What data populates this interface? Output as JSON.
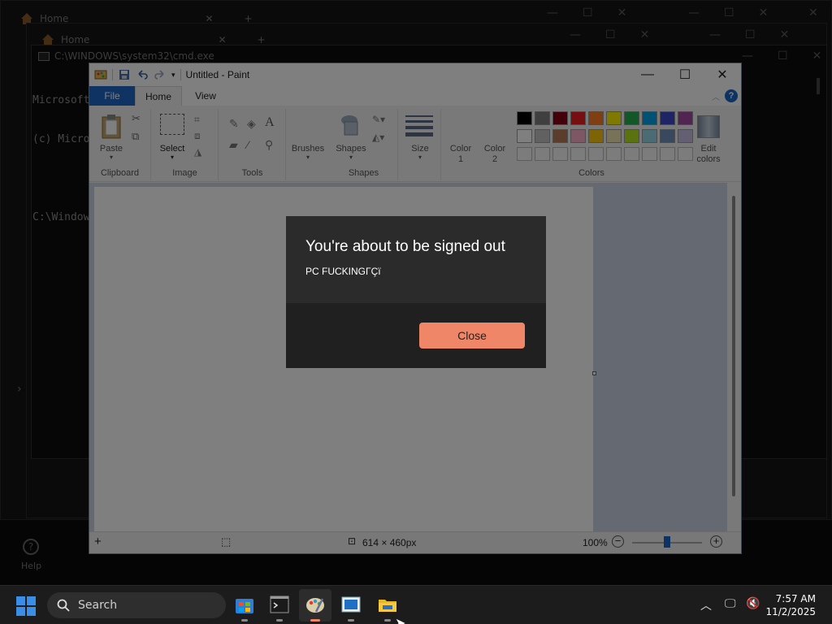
{
  "background_windows": {
    "tab1_label": "Home",
    "tab2_label": "Home",
    "help_label": "Help"
  },
  "cmd": {
    "title": "C:\\WINDOWS\\system32\\cmd.exe",
    "lines": [
      "Microsoft",
      "(c) Micro",
      "",
      "C:\\Window"
    ]
  },
  "paint": {
    "title": "Untitled - Paint",
    "menu": {
      "file": "File",
      "home": "Home",
      "view": "View"
    },
    "ribbon": {
      "paste": "Paste",
      "select": "Select",
      "brushes": "Brushes",
      "shapes": "Shapes",
      "size": "Size",
      "color1": "Color\n1",
      "color2": "Color\n2",
      "edit_colors": "Edit\ncolors",
      "groups": {
        "clipboard": "Clipboard",
        "image": "Image",
        "tools": "Tools",
        "shapes": "Shapes",
        "colors": "Colors"
      }
    },
    "palette_row1": [
      "#000000",
      "#7f7f7f",
      "#880015",
      "#ed1c24",
      "#ff7f27",
      "#fff200",
      "#22b14c",
      "#00a2e8",
      "#3f48cc",
      "#a349a4"
    ],
    "palette_row2": [
      "#ffffff",
      "#c3c3c3",
      "#b97a57",
      "#ffaec9",
      "#ffc90e",
      "#efe4b0",
      "#b5e61d",
      "#99d9ea",
      "#7092be",
      "#c8bfe7"
    ],
    "status": {
      "canvas_size": "614 × 460px",
      "zoom": "100%"
    }
  },
  "dialog": {
    "title": "You're about to be signed out",
    "message": "PC FUCKINGΓÇï",
    "close_label": "Close",
    "accent": "#f08668"
  },
  "taskbar": {
    "search_placeholder": "Search",
    "time": "7:57 AM",
    "date": "11/2/2025"
  }
}
